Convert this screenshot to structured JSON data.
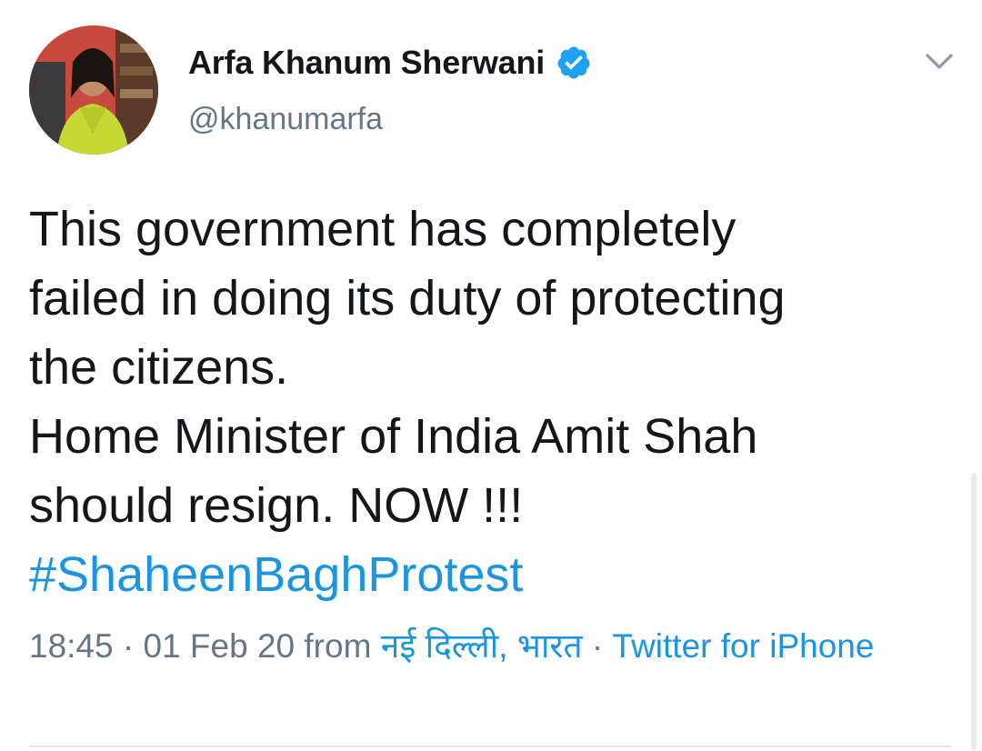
{
  "tweet": {
    "author": {
      "display_name": "Arfa Khanum Sherwani",
      "handle": "@khanumarfa",
      "verified": true,
      "verified_icon": "verified-badge-icon",
      "avatar_icon": "profile-photo"
    },
    "menu_icon": "chevron-down-icon",
    "text_lines": [
      "This government has completely",
      "failed in doing its duty of protecting",
      "the citizens.",
      "Home Minister of India Amit Shah",
      "should resign. NOW !!!"
    ],
    "hashtag": "#ShaheenBaghProtest",
    "meta": {
      "time": "18:45",
      "separator": "·",
      "date": "01 Feb 20",
      "from_label": "from",
      "location": "नई दिल्ली, भारत",
      "source": "Twitter for iPhone"
    }
  },
  "colors": {
    "text": "#14171a",
    "secondary": "#657786",
    "link": "#1b95e0",
    "divider": "#e1e8ed"
  }
}
